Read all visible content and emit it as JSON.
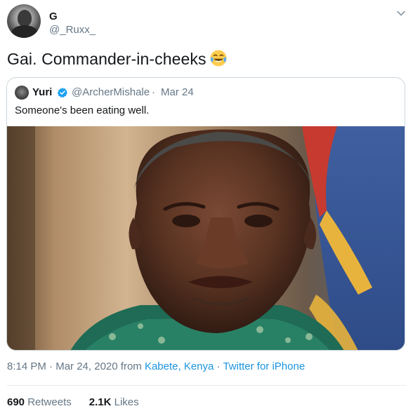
{
  "author": {
    "display_name": "G",
    "handle": "@_Ruxx_"
  },
  "tweet": {
    "text": "Gai. Commander-in-cheeks",
    "emoji": "face-with-tears-of-joy"
  },
  "quoted_tweet": {
    "display_name": "Yuri",
    "handle": "@ArcherMishale",
    "separator": "·",
    "date": "Mar 24",
    "text": "Someone's been eating well."
  },
  "meta": {
    "time": "8:14 PM",
    "sep1": " · ",
    "date": "Mar 24, 2020",
    "from_label": " from ",
    "location": "Kabete, Kenya",
    "sep2": " · ",
    "source": "Twitter for iPhone"
  },
  "stats": {
    "retweets_count": "690",
    "retweets_label": "Retweets",
    "likes_count": "2.1K",
    "likes_label": "Likes"
  },
  "colors": {
    "link": "#1b95e0",
    "verified": "#1da1f2",
    "muted": "#657786"
  }
}
